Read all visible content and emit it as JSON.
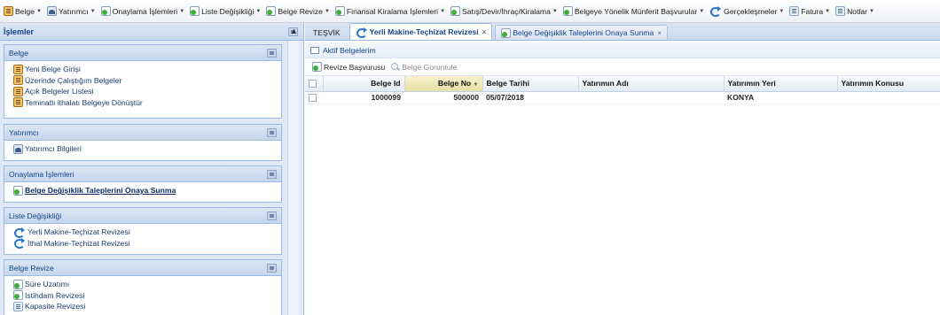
{
  "menubar": {
    "items": [
      {
        "label": "Belge",
        "icon": "document-icon"
      },
      {
        "label": "Yatırımcı",
        "icon": "investor-icon"
      },
      {
        "label": "Onaylama İşlemleri",
        "icon": "page-add-icon"
      },
      {
        "label": "Liste Değişikliği",
        "icon": "page-add-icon"
      },
      {
        "label": "Belge Revize",
        "icon": "page-add-icon"
      },
      {
        "label": "Finansal Kiralama İşlemleri",
        "icon": "page-add-icon"
      },
      {
        "label": "Satış/Devir/İhraç/Kiralama",
        "icon": "page-add-icon"
      },
      {
        "label": "Belgeye Yönelik Münferit Başvurular",
        "icon": "page-add-icon"
      },
      {
        "label": "Gerçekleşmeler",
        "icon": "refresh-icon"
      },
      {
        "label": "Fatura",
        "icon": "page-icon"
      },
      {
        "label": "Notlar",
        "icon": "note-icon"
      }
    ]
  },
  "left_panel": {
    "title": "İşlemler",
    "sections": [
      {
        "title": "Belge",
        "items": [
          {
            "label": "Yeni Belge Girişi",
            "icon": "document-icon"
          },
          {
            "label": "Üzerinde Çalıştığım Belgeler",
            "icon": "document-icon"
          },
          {
            "label": "Açık Belgeler Listesi",
            "icon": "document-icon"
          },
          {
            "label": "Teminatlı ithalatı Belgeye Dönüştür",
            "icon": "document-icon"
          }
        ]
      },
      {
        "title": "Yatırımcı",
        "items": [
          {
            "label": "Yatırımcı Bilgileri",
            "icon": "investor-icon"
          }
        ]
      },
      {
        "title": "Onaylama İşlemleri",
        "items": [
          {
            "label": "Belge Değişiklik Taleplerini Onaya Sunma",
            "icon": "page-add-icon"
          }
        ]
      },
      {
        "title": "Liste Değişikliği",
        "items": [
          {
            "label": "Yerli Makine-Teçhizat Revizesi",
            "icon": "refresh-icon"
          },
          {
            "label": "İthal Makine-Teçhizat Revizesi",
            "icon": "refresh-icon"
          }
        ]
      },
      {
        "title": "Belge Revize",
        "items": [
          {
            "label": "Süre Uzatımı",
            "icon": "page-add-icon"
          },
          {
            "label": "İstihdam Revizesi",
            "icon": "page-add-icon"
          },
          {
            "label": "Kapasite Revizesi",
            "icon": "page-icon"
          }
        ]
      }
    ]
  },
  "tabs": [
    {
      "label": "TEŞVİK",
      "state": "plain"
    },
    {
      "label": "Yerli Makine-Teçhizat Revizesi",
      "state": "active",
      "close": "×"
    },
    {
      "label": "Belge Değişiklik Taleplerini Onaya Sunma",
      "state": "inactive",
      "close": "×"
    }
  ],
  "main": {
    "section_title": "Aktif Belgelerim",
    "toolbar": {
      "revize_label": "Revize Başvurusu",
      "goruntule_label": "Belge Goruntule"
    },
    "grid": {
      "columns": [
        "Belge Id",
        "Belge No",
        "Belge Tarihi",
        "Yatırımın Adı",
        "Yatırımın Yeri",
        "Yatırımın Konusu"
      ],
      "sort_indicator": "▼",
      "rows": [
        [
          "1000099",
          "500000",
          "05/07/2018",
          "",
          "KONYA",
          ""
        ]
      ]
    }
  },
  "colors": {
    "header_blue": "#15428b",
    "panel_border": "#99bbe8",
    "sorted_header": "#e9dfa6"
  }
}
